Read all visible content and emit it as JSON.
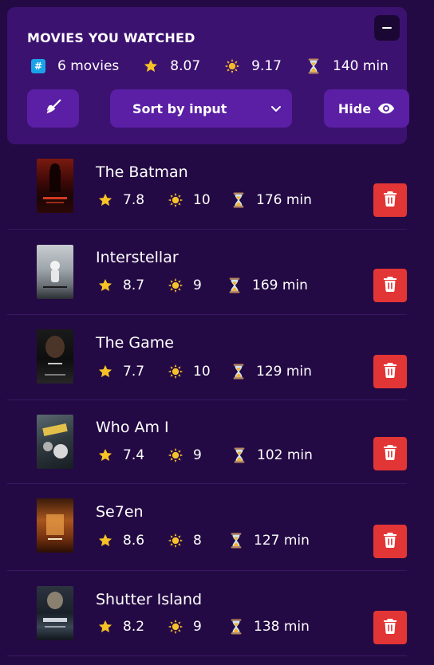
{
  "summary": {
    "title": "MOVIES YOU WATCHED",
    "count_label": "6 movies",
    "avg_imdb_rating": "8.07",
    "avg_user_rating": "9.17",
    "avg_runtime": "140 min"
  },
  "controls": {
    "sort_label": "Sort by input",
    "hide_label": "Hide"
  },
  "movies": [
    {
      "title": "The Batman",
      "imdb_rating": "7.8",
      "user_rating": "10",
      "runtime": "176 min"
    },
    {
      "title": "Interstellar",
      "imdb_rating": "8.7",
      "user_rating": "9",
      "runtime": "169 min"
    },
    {
      "title": "The Game",
      "imdb_rating": "7.7",
      "user_rating": "10",
      "runtime": "129 min"
    },
    {
      "title": "Who Am I",
      "imdb_rating": "7.4",
      "user_rating": "9",
      "runtime": "102 min"
    },
    {
      "title": "Se7en",
      "imdb_rating": "8.6",
      "user_rating": "8",
      "runtime": "127 min"
    },
    {
      "title": "Shutter Island",
      "imdb_rating": "8.2",
      "user_rating": "9",
      "runtime": "138 min"
    }
  ],
  "icons": {
    "count": "hashtag-icon",
    "imdb": "star-icon",
    "user": "sun-icon",
    "runtime": "hourglass-icon",
    "collapse": "minus-icon",
    "clear": "broom-icon",
    "sort": "chevron-down-icon",
    "hide": "eye-icon",
    "delete": "trash-icon"
  },
  "colors": {
    "background": "#240a44",
    "summary_box": "#3c1270",
    "button": "#5a1fa4",
    "delete": "#e23535",
    "star": "#f6c226"
  }
}
